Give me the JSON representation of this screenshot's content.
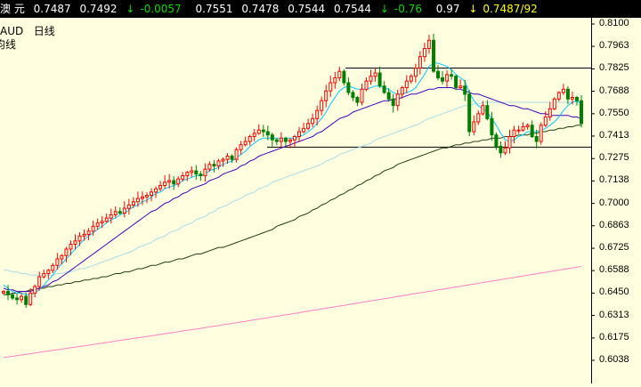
{
  "quote": {
    "name": "澳    元",
    "last": "0.7487",
    "bid": "0.7492",
    "arrow_chg": "↓",
    "change": "-0.0057",
    "high": "0.7551",
    "low": "0.7478",
    "open": "0.7544",
    "close": "0.7544",
    "arrow_pct": "↓",
    "pct": "-0.76",
    "ratio": "0.97",
    "arrow_last": "↓",
    "last_ask": "0.7487/92"
  },
  "chart_labels": {
    "symbol": "AUD",
    "period": "日线",
    "indicator": "均线"
  },
  "colors": {
    "background": "#ffffe0",
    "candle_up": "#ff0000",
    "candle_down": "#008000",
    "ma_fast": "#00c8ff",
    "ma_mid": "#4000c0",
    "ma_slow": "#a8dce8",
    "ma_long": "#204010",
    "ma_longest": "#ff80c0",
    "trendline": "#000000"
  },
  "chart_data": {
    "type": "candlestick",
    "y_ticks": [
      "0.8100",
      "0.7963",
      "0.7825",
      "0.7688",
      "0.7550",
      "0.7413",
      "0.7275",
      "0.7138",
      "0.7000",
      "0.6863",
      "0.6725",
      "0.6588",
      "0.6450",
      "0.6313",
      "0.6175",
      "0.6038"
    ],
    "ylim": [
      0.5958,
      0.815
    ],
    "horizontal_levels": [
      0.783,
      0.7345
    ],
    "n_candles": 130,
    "close": [
      0.646,
      0.644,
      0.642,
      0.641,
      0.643,
      0.638,
      0.645,
      0.649,
      0.655,
      0.657,
      0.659,
      0.662,
      0.666,
      0.668,
      0.672,
      0.675,
      0.677,
      0.68,
      0.681,
      0.683,
      0.686,
      0.688,
      0.689,
      0.691,
      0.693,
      0.695,
      0.694,
      0.697,
      0.699,
      0.701,
      0.703,
      0.704,
      0.705,
      0.707,
      0.709,
      0.711,
      0.713,
      0.714,
      0.712,
      0.715,
      0.717,
      0.719,
      0.72,
      0.718,
      0.717,
      0.721,
      0.724,
      0.723,
      0.726,
      0.727,
      0.729,
      0.727,
      0.733,
      0.736,
      0.738,
      0.741,
      0.743,
      0.745,
      0.744,
      0.742,
      0.739,
      0.738,
      0.74,
      0.738,
      0.739,
      0.741,
      0.744,
      0.746,
      0.749,
      0.752,
      0.757,
      0.763,
      0.769,
      0.774,
      0.777,
      0.781,
      0.774,
      0.768,
      0.765,
      0.762,
      0.77,
      0.775,
      0.778,
      0.78,
      0.772,
      0.768,
      0.764,
      0.76,
      0.767,
      0.771,
      0.775,
      0.778,
      0.783,
      0.79,
      0.795,
      0.8,
      0.781,
      0.777,
      0.775,
      0.779,
      0.778,
      0.771,
      0.772,
      0.767,
      0.744,
      0.75,
      0.755,
      0.76,
      0.752,
      0.742,
      0.735,
      0.731,
      0.734,
      0.741,
      0.745,
      0.745,
      0.747,
      0.748,
      0.741,
      0.738,
      0.748,
      0.753,
      0.758,
      0.764,
      0.768,
      0.77,
      0.764,
      0.765,
      0.763,
      0.749
    ],
    "ma_fast": [
      0.65,
      0.648,
      0.646,
      0.645,
      0.645,
      0.644,
      0.644,
      0.645,
      0.647,
      0.65,
      0.653,
      0.656,
      0.66,
      0.663,
      0.666,
      0.669,
      0.672,
      0.675,
      0.678,
      0.68,
      0.682,
      0.684,
      0.686,
      0.688,
      0.69,
      0.691,
      0.693,
      0.694,
      0.696,
      0.698,
      0.699,
      0.701,
      0.702,
      0.704,
      0.706,
      0.707,
      0.709,
      0.71,
      0.711,
      0.712,
      0.714,
      0.715,
      0.716,
      0.717,
      0.717,
      0.718,
      0.72,
      0.721,
      0.722,
      0.724,
      0.725,
      0.726,
      0.728,
      0.73,
      0.732,
      0.735,
      0.737,
      0.739,
      0.74,
      0.74,
      0.74,
      0.74,
      0.74,
      0.74,
      0.74,
      0.74,
      0.741,
      0.742,
      0.744,
      0.746,
      0.749,
      0.752,
      0.756,
      0.761,
      0.765,
      0.769,
      0.771,
      0.772,
      0.771,
      0.77,
      0.77,
      0.77,
      0.771,
      0.772,
      0.772,
      0.771,
      0.77,
      0.768,
      0.767,
      0.767,
      0.768,
      0.769,
      0.771,
      0.775,
      0.779,
      0.784,
      0.786,
      0.786,
      0.785,
      0.784,
      0.782,
      0.779,
      0.777,
      0.775,
      0.768,
      0.763,
      0.76,
      0.758,
      0.756,
      0.752,
      0.748,
      0.743,
      0.739,
      0.738,
      0.739,
      0.741,
      0.742,
      0.744,
      0.744,
      0.744,
      0.745,
      0.746,
      0.748,
      0.75,
      0.753,
      0.757,
      0.76,
      0.762,
      0.763,
      0.761
    ],
    "ma_mid": [
      0.648,
      0.647,
      0.647,
      0.646,
      0.646,
      0.646,
      0.646,
      0.647,
      0.648,
      0.649,
      0.65,
      0.652,
      0.653,
      0.655,
      0.657,
      0.659,
      0.661,
      0.663,
      0.665,
      0.667,
      0.669,
      0.671,
      0.673,
      0.675,
      0.677,
      0.679,
      0.681,
      0.683,
      0.685,
      0.687,
      0.689,
      0.691,
      0.693,
      0.695,
      0.696,
      0.698,
      0.7,
      0.701,
      0.703,
      0.704,
      0.706,
      0.707,
      0.709,
      0.71,
      0.711,
      0.712,
      0.714,
      0.715,
      0.716,
      0.718,
      0.719,
      0.72,
      0.721,
      0.723,
      0.724,
      0.726,
      0.727,
      0.729,
      0.73,
      0.731,
      0.732,
      0.733,
      0.734,
      0.735,
      0.736,
      0.737,
      0.738,
      0.739,
      0.74,
      0.741,
      0.743,
      0.744,
      0.746,
      0.748,
      0.75,
      0.752,
      0.753,
      0.754,
      0.756,
      0.757,
      0.758,
      0.759,
      0.76,
      0.761,
      0.762,
      0.763,
      0.763,
      0.764,
      0.764,
      0.765,
      0.766,
      0.767,
      0.767,
      0.768,
      0.769,
      0.77,
      0.77,
      0.771,
      0.771,
      0.771,
      0.771,
      0.77,
      0.77,
      0.769,
      0.768,
      0.767,
      0.767,
      0.766,
      0.765,
      0.764,
      0.763,
      0.762,
      0.761,
      0.76,
      0.76,
      0.759,
      0.758,
      0.758,
      0.757,
      0.756,
      0.755,
      0.755,
      0.754,
      0.754,
      0.754,
      0.754,
      0.754,
      0.753,
      0.753,
      0.752
    ],
    "ma_slow": [
      0.659,
      0.659,
      0.658,
      0.658,
      0.657,
      0.657,
      0.656,
      0.656,
      0.656,
      0.656,
      0.656,
      0.656,
      0.657,
      0.657,
      0.658,
      0.658,
      0.659,
      0.66,
      0.66,
      0.661,
      0.662,
      0.663,
      0.664,
      0.665,
      0.666,
      0.667,
      0.668,
      0.669,
      0.67,
      0.671,
      0.673,
      0.674,
      0.675,
      0.676,
      0.678,
      0.679,
      0.68,
      0.682,
      0.683,
      0.684,
      0.686,
      0.687,
      0.688,
      0.69,
      0.691,
      0.692,
      0.694,
      0.695,
      0.697,
      0.698,
      0.699,
      0.701,
      0.702,
      0.703,
      0.705,
      0.706,
      0.707,
      0.709,
      0.71,
      0.711,
      0.713,
      0.714,
      0.715,
      0.716,
      0.717,
      0.718,
      0.719,
      0.72,
      0.721,
      0.722,
      0.723,
      0.724,
      0.726,
      0.727,
      0.728,
      0.73,
      0.731,
      0.732,
      0.733,
      0.734,
      0.735,
      0.736,
      0.737,
      0.739,
      0.74,
      0.741,
      0.742,
      0.743,
      0.744,
      0.745,
      0.746,
      0.747,
      0.748,
      0.749,
      0.751,
      0.752,
      0.753,
      0.754,
      0.755,
      0.756,
      0.757,
      0.758,
      0.759,
      0.76,
      0.76,
      0.761,
      0.761,
      0.762,
      0.762,
      0.762,
      0.762,
      0.762,
      0.762,
      0.762,
      0.762,
      0.762,
      0.762,
      0.762,
      0.762,
      0.762,
      0.762,
      0.762,
      0.762,
      0.762,
      0.762,
      0.762,
      0.762,
      0.762,
      0.762,
      0.761
    ],
    "ma_long": [
      0.644,
      0.644,
      0.645,
      0.645,
      0.646,
      0.646,
      0.647,
      0.647,
      0.648,
      0.648,
      0.649,
      0.649,
      0.65,
      0.65,
      0.651,
      0.651,
      0.652,
      0.652,
      0.653,
      0.653,
      0.654,
      0.654,
      0.655,
      0.655,
      0.656,
      0.657,
      0.657,
      0.658,
      0.658,
      0.659,
      0.66,
      0.66,
      0.661,
      0.662,
      0.662,
      0.663,
      0.664,
      0.664,
      0.665,
      0.666,
      0.666,
      0.667,
      0.668,
      0.669,
      0.669,
      0.67,
      0.671,
      0.672,
      0.673,
      0.673,
      0.674,
      0.675,
      0.676,
      0.677,
      0.678,
      0.679,
      0.68,
      0.681,
      0.682,
      0.683,
      0.684,
      0.686,
      0.687,
      0.688,
      0.689,
      0.69,
      0.692,
      0.693,
      0.694,
      0.696,
      0.697,
      0.699,
      0.7,
      0.702,
      0.703,
      0.705,
      0.706,
      0.708,
      0.709,
      0.711,
      0.712,
      0.714,
      0.715,
      0.717,
      0.718,
      0.72,
      0.721,
      0.722,
      0.724,
      0.725,
      0.726,
      0.727,
      0.728,
      0.729,
      0.73,
      0.731,
      0.732,
      0.733,
      0.734,
      0.734,
      0.735,
      0.736,
      0.736,
      0.737,
      0.737,
      0.738,
      0.738,
      0.739,
      0.739,
      0.74,
      0.74,
      0.74,
      0.741,
      0.741,
      0.741,
      0.742,
      0.742,
      0.742,
      0.743,
      0.743,
      0.744,
      0.744,
      0.745,
      0.745,
      0.746,
      0.746,
      0.747,
      0.747,
      0.748,
      0.748
    ],
    "ma_longest": [
      0.6055,
      0.6059,
      0.6063,
      0.6067,
      0.6071,
      0.6075,
      0.6079,
      0.6083,
      0.6087,
      0.6091,
      0.6095,
      0.6099,
      0.6103,
      0.6107,
      0.6111,
      0.6115,
      0.6119,
      0.6123,
      0.6127,
      0.6131,
      0.6135,
      0.6139,
      0.6143,
      0.6147,
      0.6151,
      0.6156,
      0.616,
      0.6164,
      0.6168,
      0.6172,
      0.6176,
      0.618,
      0.6184,
      0.6188,
      0.6193,
      0.6197,
      0.6201,
      0.6205,
      0.6209,
      0.6213,
      0.6218,
      0.6222,
      0.6226,
      0.623,
      0.6234,
      0.6239,
      0.6243,
      0.6247,
      0.6251,
      0.6256,
      0.626,
      0.6264,
      0.6269,
      0.6273,
      0.6277,
      0.6282,
      0.6286,
      0.629,
      0.6295,
      0.6299,
      0.6304,
      0.6308,
      0.6312,
      0.6317,
      0.6321,
      0.6326,
      0.633,
      0.6335,
      0.6339,
      0.6344,
      0.6348,
      0.6353,
      0.6357,
      0.6362,
      0.6366,
      0.6371,
      0.6375,
      0.638,
      0.6384,
      0.6389,
      0.6393,
      0.6398,
      0.6402,
      0.6407,
      0.6411,
      0.6416,
      0.642,
      0.6425,
      0.6429,
      0.6434,
      0.6438,
      0.6443,
      0.6447,
      0.6452,
      0.6456,
      0.6461,
      0.6465,
      0.647,
      0.6474,
      0.6479,
      0.6483,
      0.6488,
      0.6492,
      0.6497,
      0.6501,
      0.6506,
      0.651,
      0.6515,
      0.6519,
      0.6524,
      0.6528,
      0.6533,
      0.6537,
      0.6542,
      0.6546,
      0.6551,
      0.6555,
      0.656,
      0.6564,
      0.6569,
      0.6573,
      0.6578,
      0.6582,
      0.6587,
      0.6591,
      0.6596,
      0.66,
      0.6605,
      0.6609,
      0.6613
    ]
  }
}
